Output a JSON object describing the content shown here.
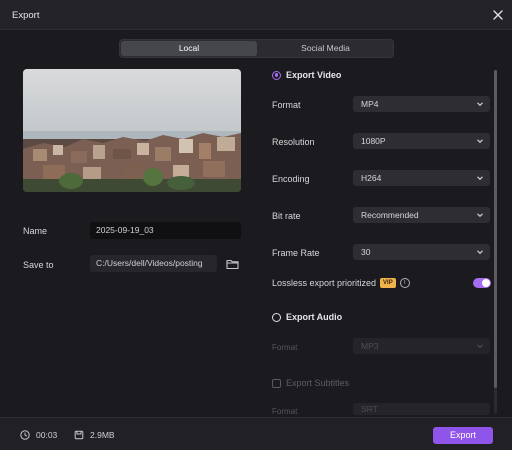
{
  "window": {
    "title": "Export"
  },
  "tabs": {
    "local": "Local",
    "social": "Social Media"
  },
  "left": {
    "name_label": "Name",
    "name_value": "2025-09-19_03",
    "save_label": "Save to",
    "save_path": "C:/Users/dell/Videos/posting"
  },
  "video": {
    "header": "Export Video",
    "format_label": "Format",
    "format_value": "MP4",
    "resolution_label": "Resolution",
    "resolution_value": "1080P",
    "encoding_label": "Encoding",
    "encoding_value": "H264",
    "bitrate_label": "Bit rate",
    "bitrate_value": "Recommended",
    "framerate_label": "Frame Rate",
    "framerate_value": "30",
    "lossless_label": "Lossless export prioritized",
    "vip_badge": "VIP",
    "info_glyph": "i"
  },
  "audio": {
    "header": "Export Audio",
    "format_label": "Format",
    "format_value": "MP3"
  },
  "subtitles": {
    "header": "Export Subtitles",
    "format_label": "Format",
    "format_value": "SRT"
  },
  "footer": {
    "duration": "00:03",
    "size": "2.9MB",
    "export_label": "Export"
  },
  "colors": {
    "accent": "#a66cf2",
    "button": "#8f55ea",
    "vip": "#f0b24a"
  },
  "icons": [
    "close-icon",
    "folder-icon",
    "clock-icon",
    "file-size-icon",
    "chevron-down-icon",
    "info-icon"
  ]
}
